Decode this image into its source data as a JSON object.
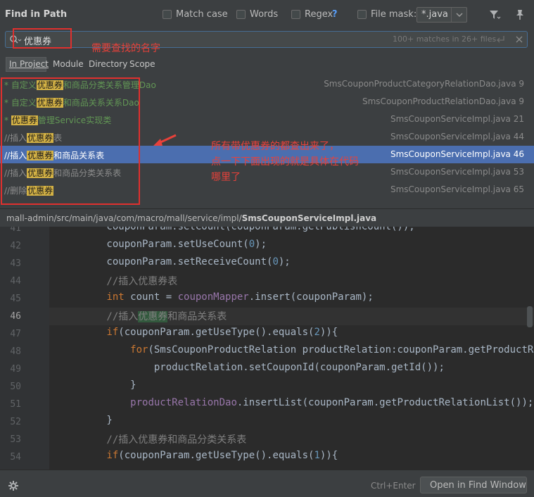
{
  "dialog": {
    "title": "Find in Path",
    "options": [
      {
        "label": "Match case",
        "checked": false
      },
      {
        "label": "Words",
        "checked": false
      },
      {
        "label": "Regex",
        "checked": false,
        "help": "?"
      },
      {
        "label": "File mask:",
        "checked": false
      }
    ],
    "file_mask_value": "*.java",
    "search_value": "优惠券",
    "match_summary": "100+ matches in 26+ files"
  },
  "scope_tabs": [
    "In Project",
    "Module",
    "Directory",
    "Scope"
  ],
  "results": [
    {
      "prefix": "* 自定义",
      "match": "优惠券",
      "suffix": "和商品分类关系管理Dao",
      "file": "SmsCouponProductCategoryRelationDao.java 9",
      "style": "green",
      "selected": false
    },
    {
      "prefix": "* 自定义",
      "match": "优惠券",
      "suffix": "和商品关系关系Dao",
      "file": "SmsCouponProductRelationDao.java 9",
      "style": "green",
      "selected": false
    },
    {
      "prefix": "* ",
      "match": "优惠券",
      "suffix": "管理Service实现类",
      "file": "SmsCouponServiceImpl.java 21",
      "style": "green",
      "selected": false
    },
    {
      "prefix": "//插入",
      "match": "优惠券",
      "suffix": "表",
      "file": "SmsCouponServiceImpl.java 44",
      "style": "gray",
      "selected": false
    },
    {
      "prefix": "//插入",
      "match": "优惠券",
      "suffix": "和商品关系表",
      "file": "SmsCouponServiceImpl.java 46",
      "style": "gray",
      "selected": true
    },
    {
      "prefix": "//插入",
      "match": "优惠券",
      "suffix": "和商品分类关系表",
      "file": "SmsCouponServiceImpl.java 53",
      "style": "gray",
      "selected": false
    },
    {
      "prefix": "//删除",
      "match": "优惠券",
      "suffix": "",
      "file": "SmsCouponServiceImpl.java 65",
      "style": "gray",
      "selected": false
    }
  ],
  "path": {
    "dir": "mall-admin/src/main/java/com/macro/mall/service/impl/",
    "file": "SmsCouponServiceImpl.java"
  },
  "editor": {
    "current_line": "46",
    "lines": [
      {
        "n": "41",
        "tokens": [
          {
            "t": "        couponParam.setCount(couponParam.getPublishCount());"
          }
        ]
      },
      {
        "n": "42",
        "tokens": [
          {
            "t": "        couponParam.setUseCount("
          },
          {
            "t": "0",
            "c": "num"
          },
          {
            "t": ");"
          }
        ]
      },
      {
        "n": "43",
        "tokens": [
          {
            "t": "        couponParam.setReceiveCount("
          },
          {
            "t": "0",
            "c": "num"
          },
          {
            "t": ");"
          }
        ]
      },
      {
        "n": "44",
        "tokens": [
          {
            "t": "        //插入优惠券表",
            "c": "cmt"
          }
        ]
      },
      {
        "n": "45",
        "tokens": [
          {
            "t": "        "
          },
          {
            "t": "int",
            "c": "kw"
          },
          {
            "t": " count = "
          },
          {
            "t": "couponMapper",
            "c": "fld"
          },
          {
            "t": ".insert(couponParam);"
          }
        ]
      },
      {
        "n": "46",
        "tokens": [
          {
            "t": "        //插入",
            "c": "cmt"
          },
          {
            "t": "优惠券",
            "c": "cmt-hl"
          },
          {
            "t": "和商品关系表",
            "c": "cmt"
          }
        ]
      },
      {
        "n": "47",
        "tokens": [
          {
            "t": "        "
          },
          {
            "t": "if",
            "c": "kw"
          },
          {
            "t": "(couponParam.getUseType().equals("
          },
          {
            "t": "2",
            "c": "num"
          },
          {
            "t": ")){"
          }
        ]
      },
      {
        "n": "48",
        "tokens": [
          {
            "t": "            "
          },
          {
            "t": "for",
            "c": "kw"
          },
          {
            "t": "(SmsCouponProductRelation productRelation:couponParam.getProductRelationList()){"
          }
        ]
      },
      {
        "n": "49",
        "tokens": [
          {
            "t": "                productRelation.setCouponId(couponParam.getId());"
          }
        ]
      },
      {
        "n": "50",
        "tokens": [
          {
            "t": "            }"
          }
        ]
      },
      {
        "n": "51",
        "tokens": [
          {
            "t": "            "
          },
          {
            "t": "productRelationDao",
            "c": "fld"
          },
          {
            "t": ".insertList(couponParam.getProductRelationList());"
          }
        ]
      },
      {
        "n": "52",
        "tokens": [
          {
            "t": "        }"
          }
        ]
      },
      {
        "n": "53",
        "tokens": [
          {
            "t": "        //插入优惠券和商品分类关系表",
            "c": "cmt"
          }
        ]
      },
      {
        "n": "54",
        "tokens": [
          {
            "t": "        "
          },
          {
            "t": "if",
            "c": "kw"
          },
          {
            "t": "(couponParam.getUseType().equals("
          },
          {
            "t": "1",
            "c": "num"
          },
          {
            "t": ")){"
          }
        ]
      }
    ]
  },
  "footer": {
    "shortcut": "Ctrl+Enter",
    "open_button": "Open in Find Window"
  },
  "annotations": {
    "search_note": "需要查找的名字",
    "result_note_1": "所有带优惠券的都查出来了，",
    "result_note_2": "点一下下面出现的就是具体在代码",
    "result_note_3": "哪里了"
  },
  "colors": {
    "accent": "#4b6eaf",
    "highlight": "#d4b245",
    "annotation": "#e8413a"
  }
}
